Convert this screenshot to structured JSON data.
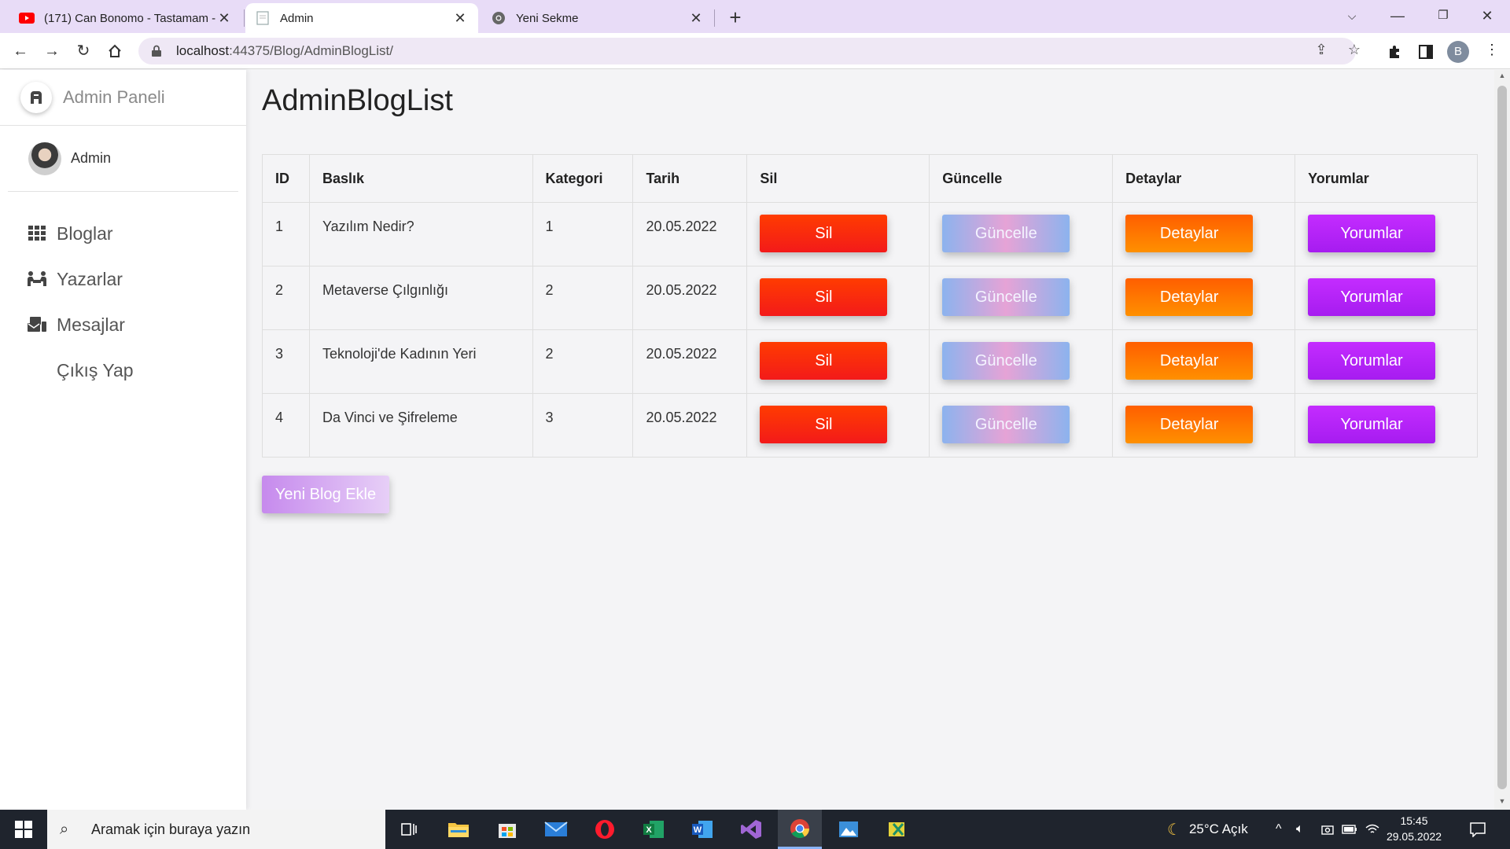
{
  "browser": {
    "tabs": [
      {
        "label": "(171) Can Bonomo - Tastamam -",
        "icon": "youtube-icon"
      },
      {
        "label": "Admin",
        "icon": "page-icon"
      },
      {
        "label": "Yeni Sekme",
        "icon": "chrome-icon"
      }
    ],
    "url_host": "localhost",
    "url_path": ":44375/Blog/AdminBlogList/",
    "profile_initial": "B"
  },
  "sidebar": {
    "brand": "Admin Paneli",
    "user": "Admin",
    "items": [
      {
        "label": "Bloglar",
        "icon": "grid-icon"
      },
      {
        "label": "Yazarlar",
        "icon": "people-icon"
      },
      {
        "label": "Mesajlar",
        "icon": "messages-icon"
      },
      {
        "label": "Çıkış Yap",
        "icon": ""
      }
    ]
  },
  "main": {
    "title": "AdminBlogList",
    "columns": [
      "ID",
      "Baslık",
      "Kategori",
      "Tarih",
      "Sil",
      "Güncelle",
      "Detaylar",
      "Yorumlar"
    ],
    "rows": [
      {
        "id": "1",
        "title": "Yazılım Nedir?",
        "category": "1",
        "date": "20.05.2022"
      },
      {
        "id": "2",
        "title": "Metaverse Çılgınlığı",
        "category": "2",
        "date": "20.05.2022"
      },
      {
        "id": "3",
        "title": "Teknoloji'de Kadının Yeri",
        "category": "2",
        "date": "20.05.2022"
      },
      {
        "id": "4",
        "title": "Da Vinci ve Şifreleme",
        "category": "3",
        "date": "20.05.2022"
      }
    ],
    "buttons": {
      "delete": "Sil",
      "update": "Güncelle",
      "details": "Detaylar",
      "comments": "Yorumlar"
    },
    "add_button": "Yeni Blog Ekle"
  },
  "taskbar": {
    "search_placeholder": "Aramak için buraya yazın",
    "weather": "25°C  Açık",
    "time": "15:45",
    "date": "29.05.2022"
  },
  "colors": {
    "delete": "#f72b0e",
    "update": "#b7aae3",
    "details": "#ff7a00",
    "comments": "#b524f7",
    "add": "#d5aaf2"
  }
}
